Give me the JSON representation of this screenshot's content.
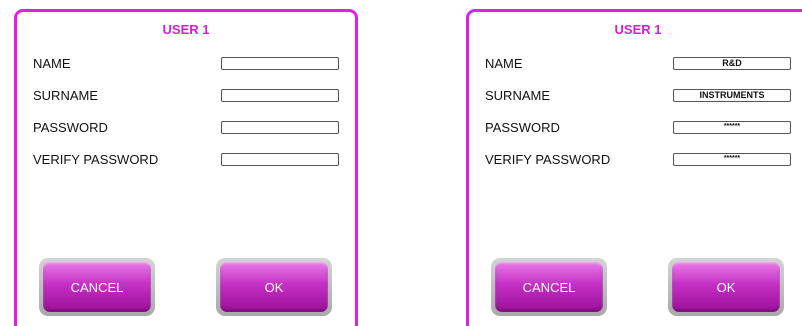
{
  "left_panel": {
    "title": "USER 1",
    "fields": [
      {
        "label": "NAME",
        "value": ""
      },
      {
        "label": "SURNAME",
        "value": ""
      },
      {
        "label": "PASSWORD",
        "value": ""
      },
      {
        "label": "VERIFY PASSWORD",
        "value": ""
      }
    ],
    "cancel_label": "CANCEL",
    "ok_label": "OK"
  },
  "right_panel": {
    "title": "USER 1",
    "fields": [
      {
        "label": "NAME",
        "value": "R&D"
      },
      {
        "label": "SURNAME",
        "value": "INSTRUMENTS"
      },
      {
        "label": "PASSWORD",
        "value": "******"
      },
      {
        "label": "VERIFY PASSWORD",
        "value": "******"
      }
    ],
    "cancel_label": "CANCEL",
    "ok_label": "OK"
  },
  "colors": {
    "accent": "#e31ee3",
    "title": "#d61ed6",
    "button_top": "#e87ce8",
    "button_bottom": "#9a109a"
  }
}
